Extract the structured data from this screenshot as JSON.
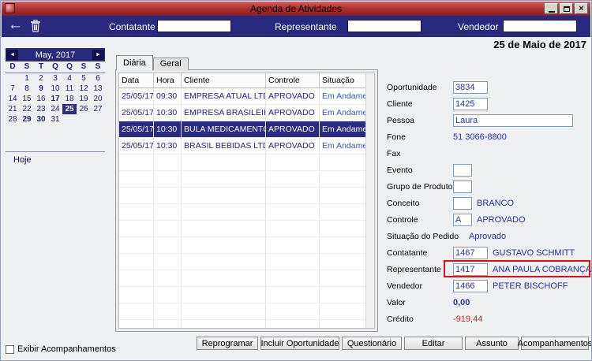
{
  "window": {
    "title": "Agenda de Atividades",
    "date_header": "25 de Maio de 2017"
  },
  "icons": {
    "back": "←",
    "trash": "trash-can",
    "prev": "◄",
    "next": "►",
    "minimize": "minimize",
    "maximize": "maximize",
    "close": "×"
  },
  "toolbar": {
    "contatante_label": "Contatante",
    "representante_label": "Representante",
    "vendedor_label": "Vendedor",
    "contatante_value": "",
    "representante_value": "",
    "vendedor_value": ""
  },
  "calendar": {
    "month_label": "May, 2017",
    "day_headers": [
      "D",
      "S",
      "T",
      "Q",
      "Q",
      "S",
      "S"
    ],
    "weeks": [
      [
        "",
        "1",
        "2",
        "3",
        "4",
        "5",
        "6"
      ],
      [
        "7",
        "8",
        "9",
        "10",
        "11",
        "12",
        "13"
      ],
      [
        "14",
        "15",
        "16",
        "17",
        "18",
        "19",
        "20"
      ],
      [
        "21",
        "22",
        "23",
        "24",
        "25",
        "26",
        "27"
      ],
      [
        "28",
        "29",
        "30",
        "31",
        "",
        "",
        ""
      ]
    ],
    "bold_days": [
      "9",
      "17",
      "29",
      "30"
    ],
    "selected_day": "25",
    "today_label": "Hoje"
  },
  "tabs": {
    "diaria": "Diária",
    "geral": "Geral"
  },
  "table": {
    "columns": [
      "Data",
      "Hora",
      "Cliente",
      "Controle",
      "Situação"
    ],
    "rows": [
      {
        "data": "25/05/17",
        "hora": "09:30",
        "cliente": "EMPRESA ATUAL LTDA",
        "controle": "APROVADO",
        "situacao": "Em Andamento",
        "selected": false
      },
      {
        "data": "25/05/17",
        "hora": "10:30",
        "cliente": "EMPRESA BRASILEIRA LTDA",
        "controle": "APROVADO",
        "situacao": "Em Andamento",
        "selected": false
      },
      {
        "data": "25/05/17",
        "hora": "10:30",
        "cliente": "BULA MEDICAMENTOS LTDA",
        "controle": "APROVADO",
        "situacao": "Em Andamento",
        "selected": true
      },
      {
        "data": "25/05/17",
        "hora": "10:30",
        "cliente": "BRASIL BEBIDAS LTDA",
        "controle": "APROVADO",
        "situacao": "Em Andamento",
        "selected": false
      }
    ]
  },
  "details": {
    "oportunidade": {
      "label": "Oportunidade",
      "value": "3834"
    },
    "cliente": {
      "label": "Cliente",
      "value": "1425"
    },
    "pessoa": {
      "label": "Pessoa",
      "value": "Laura"
    },
    "fone": {
      "label": "Fone",
      "value": "51 3066-8800"
    },
    "fax": {
      "label": "Fax",
      "value": ""
    },
    "evento": {
      "label": "Evento",
      "value": ""
    },
    "grupo_de_produtos": {
      "label": "Grupo de Produtos",
      "value": ""
    },
    "conceito": {
      "label": "Conceito",
      "value": "",
      "text": "BRANCO"
    },
    "controle": {
      "label": "Controle",
      "value": "A",
      "text": "APROVADO"
    },
    "situacao_do_pedido": {
      "label": "Situação do Pedido",
      "text": "Aprovado"
    },
    "contatante": {
      "label": "Contatante",
      "value": "1467",
      "text": "GUSTAVO SCHMITT"
    },
    "representante": {
      "label": "Representante",
      "value": "1417",
      "text": "ANA PAULA COBRANÇAS S.A.",
      "highlighted": true
    },
    "vendedor": {
      "label": "Vendedor",
      "value": "1466",
      "text": "PETER BISCHOFF"
    },
    "valor": {
      "label": "Valor",
      "text": "0,00"
    },
    "credito": {
      "label": "Crédito",
      "text": "-919,44"
    }
  },
  "buttons": {
    "reprogramar": "Reprogramar",
    "incluir_oportunidade": "Incluir Oportunidade",
    "questionario": "Questionário",
    "editar": "Editar",
    "assunto": "Assunto",
    "acompanhamentos": "Acompanhamentos"
  },
  "footer": {
    "checkbox_label": "Exibir Acompanhamentos"
  },
  "colors": {
    "titlebar_red": "#b23232",
    "toolbar_navy": "#29297d",
    "selection_navy": "#2b2b86",
    "value_blue": "#2233aa",
    "status_blue": "#2f55cc",
    "negative_red": "#cc2222",
    "highlight_red": "#e01010"
  }
}
